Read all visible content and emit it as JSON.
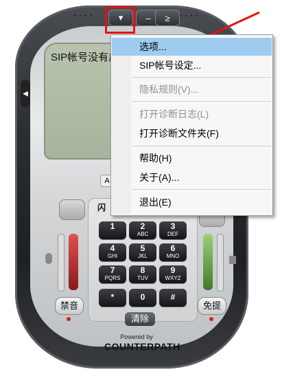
{
  "lcd": {
    "text": "SIP帐号没有启"
  },
  "titlebar": {
    "menu_glyph": "▾",
    "minimize_glyph": "–",
    "compact_glyph": "≥"
  },
  "menu": {
    "items": [
      {
        "label": "选项...",
        "selected": true,
        "enabled": true
      },
      {
        "label": "SIP帐号设定...",
        "selected": false,
        "enabled": true
      },
      {
        "label": "隐私规则(V)...",
        "selected": false,
        "enabled": false
      },
      {
        "label": "打开诊断日志(L)",
        "selected": false,
        "enabled": false
      },
      {
        "label": "打开诊断文件夹(F)",
        "selected": false,
        "enabled": true
      },
      {
        "label": "帮助(H)",
        "selected": false,
        "enabled": true
      },
      {
        "label": "关于(A)...",
        "selected": false,
        "enabled": true
      },
      {
        "label": "退出(E)",
        "selected": false,
        "enabled": true
      }
    ]
  },
  "keypad": {
    "flash_label": "闪",
    "abc_tab": "A",
    "keys": [
      {
        "digit": "1",
        "letters": ""
      },
      {
        "digit": "2",
        "letters": "ABC"
      },
      {
        "digit": "3",
        "letters": "DEF"
      },
      {
        "digit": "4",
        "letters": "GHI"
      },
      {
        "digit": "5",
        "letters": "JKL"
      },
      {
        "digit": "6",
        "letters": "MNO"
      },
      {
        "digit": "7",
        "letters": "PQRS"
      },
      {
        "digit": "8",
        "letters": "TUV"
      },
      {
        "digit": "9",
        "letters": "WXYZ"
      },
      {
        "digit": "*",
        "letters": ""
      },
      {
        "digit": "0",
        "letters": ""
      },
      {
        "digit": "#",
        "letters": ""
      }
    ],
    "clear_label": "清除"
  },
  "controls": {
    "mute_label": "禁音",
    "speaker_label": "免提"
  },
  "brand": {
    "powered": "Powered by",
    "name": "COUNTERPATH"
  },
  "decor": {
    "dots": "• • • •"
  },
  "colors": {
    "highlight": "#e01414",
    "menu_selected": "#9ecbf0",
    "mic_meter": "#e05050",
    "spk_meter": "#7cc050"
  }
}
